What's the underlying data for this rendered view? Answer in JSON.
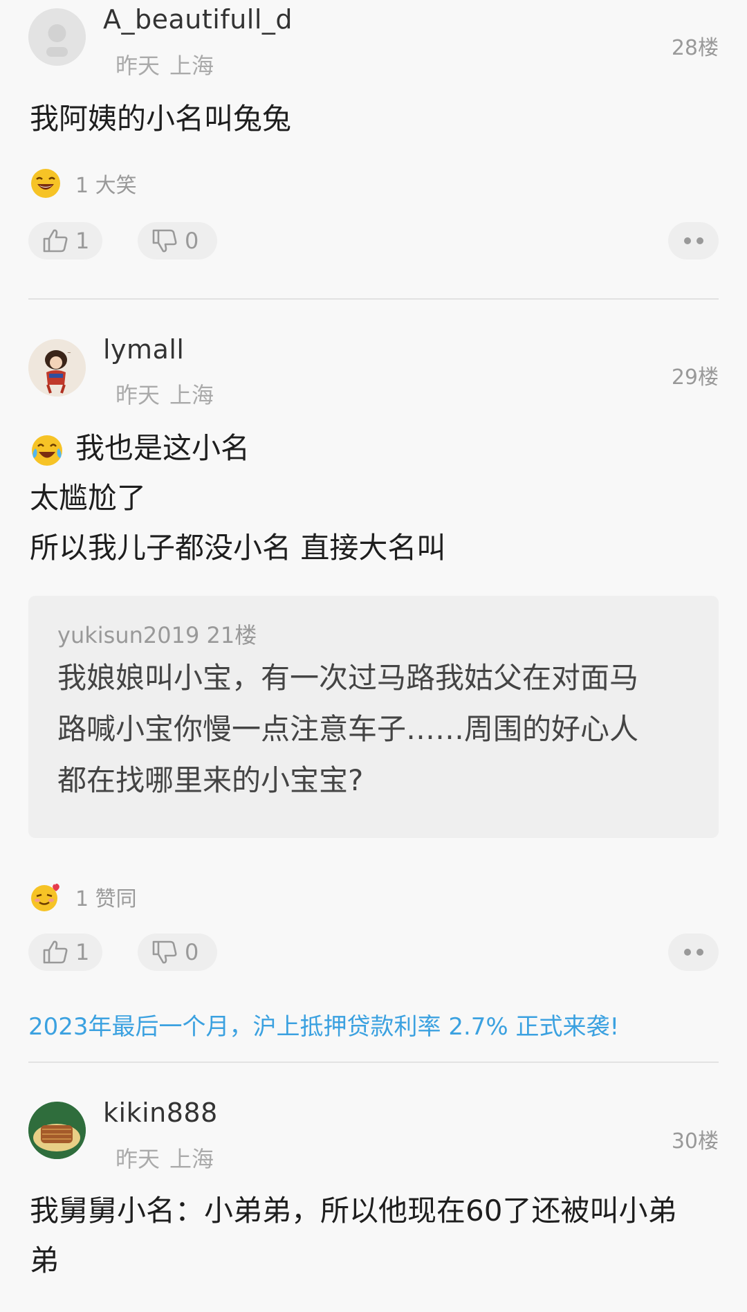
{
  "comments": [
    {
      "username": "A_beautifull_d",
      "time": "昨天",
      "location": "上海",
      "floor": "28楼",
      "lines": [
        "我阿姨的小名叫兔兔"
      ],
      "reaction": "1 大笑",
      "likes": "1",
      "dislikes": "0"
    },
    {
      "username": "lymall",
      "time": "昨天",
      "location": "上海",
      "floor": "29楼",
      "lines": [
        "我也是这小名",
        "太尴尬了",
        "所以我儿子都没小名 直接大名叫"
      ],
      "quote": {
        "header": "yukisun2019 21楼",
        "lines": [
          "我娘娘叫小宝，有一次过马路我姑父在对面马",
          "路喊小宝你慢一点注意车子……周围的好心人",
          "都在找哪里来的小宝宝?"
        ]
      },
      "reaction": "1 赞同",
      "likes": "1",
      "dislikes": "0"
    },
    {
      "username": "kikin888",
      "time": "昨天",
      "location": "上海",
      "floor": "30楼",
      "lines": [
        "我舅舅小名：小弟弟，所以他现在60了还被叫小弟",
        "弟"
      ]
    }
  ],
  "ad": "2023年最后一个月，沪上抵押贷款利率 2.7% 正式来袭!",
  "icons": {
    "like": "thumbs-up-icon",
    "dislike": "thumbs-down-icon",
    "more": "more-dots-icon"
  }
}
